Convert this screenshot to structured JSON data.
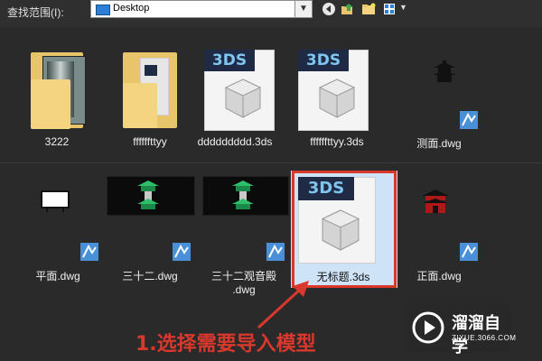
{
  "toolbar": {
    "look_in_label": "查找范围(I):",
    "location": "Desktop",
    "back_icon": "back-arrow-icon",
    "up_icon": "up-folder-icon",
    "new_folder_icon": "new-folder-icon",
    "view_icon": "view-menu-icon"
  },
  "files": [
    {
      "name": "3222",
      "type": "folder"
    },
    {
      "name": "ffffffttyy",
      "type": "folder"
    },
    {
      "name": "ddddddddd.3ds",
      "type": "3ds"
    },
    {
      "name": "ffffffttyy.3ds",
      "type": "3ds"
    },
    {
      "name": "测面.dwg",
      "type": "dwg"
    },
    {
      "name": "平面.dwg",
      "type": "dwg"
    },
    {
      "name": "三十二.dwg",
      "type": "dwg"
    },
    {
      "name": "三十二观音殿",
      "name_line2": ".dwg",
      "type": "dwg"
    },
    {
      "name": "无标题.3ds",
      "type": "3ds",
      "selected": true
    },
    {
      "name": "正面.dwg",
      "type": "dwg"
    }
  ],
  "badge_text": "3DS",
  "annotation": "1.选择需要导入模型",
  "watermark": {
    "title": "溜溜自学",
    "url": "ZIXUE.3066.COM"
  },
  "colors": {
    "highlight": "#d9382c",
    "selection": "#cfe3f6",
    "folder": "#f4d480"
  }
}
